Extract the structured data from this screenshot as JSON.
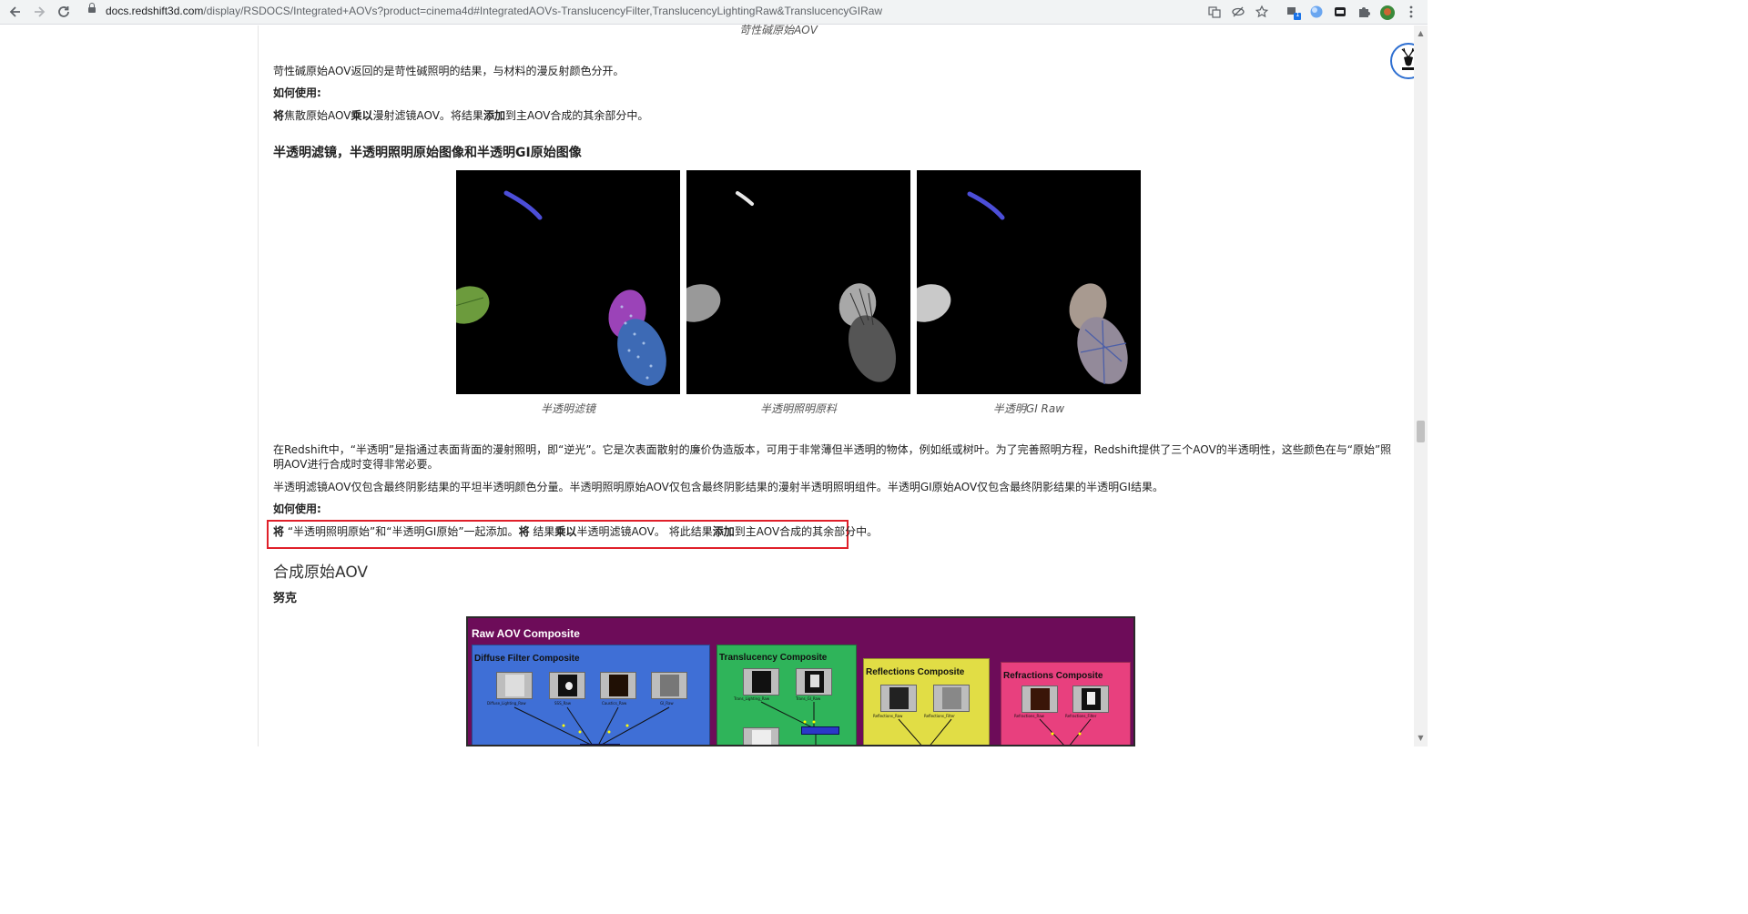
{
  "browser": {
    "url_host": "docs.redshift3d.com",
    "url_path": "/display/RSDOCS/Integrated+AOVs?product=cinema4d#IntegratedAOVs-TranslucencyFilter,TranslucencyLightingRaw&TranslucencyGIRaw",
    "nav_icons": [
      "back-icon",
      "forward-icon",
      "reload-icon"
    ],
    "toolbar_icons": [
      "translate-icon",
      "eye-off-icon",
      "star-icon",
      "extension-badge-icon",
      "globe-icon",
      "media-icon",
      "puzzle-icon",
      "profile-avatar-icon",
      "menu-kebab-icon"
    ],
    "extension_badge_count": "1"
  },
  "caustic_section": {
    "prev_caption": "苛性碱原始AOV",
    "desc": "苛性碱原始AOV返回的是苛性碱照明的结果，与材料的漫反射颜色分开。",
    "howto_label": "如何使用:",
    "howto_text": {
      "p1": "将",
      "p2": "焦散原始AOV",
      "p3": "乘以",
      "p4": "漫射滤镜AOV。将结果",
      "p5": "添加",
      "p6": "到主AOV合成的其余部分中。"
    }
  },
  "translucency_section": {
    "heading": "半透明滤镜，半透明照明原始图像和半透明GI原始图像",
    "images": [
      {
        "caption": "半透明滤镜"
      },
      {
        "caption": "半透明照明原料"
      },
      {
        "caption": "半透明GI Raw"
      }
    ],
    "para1_line1": "在Redshift中，“半透明”是指通过表面背面的漫射照明，即“逆光”。它是次表面散射的廉价伪造版本，可用于非常薄但半透明的物体，例如纸或树叶。为了完善照明方程，Redshift提供了三个AOV的半透明性，这些颜色在与“原始”照",
    "para1_line2": "明AOV进行合成时变得非常必要。",
    "para2": "半透明滤镜AOV仅包含最终阴影结果的平坦半透明颜色分量。半透明照明原始AOV仅包含最终阴影结果的漫射半透明照明组件。半透明GI原始AOV仅包含最终阴影结果的半透明GI结果。",
    "howto_label": "如何使用:",
    "howto_text": {
      "p1": "将",
      "p2": "“半透明照明原始”和“半透明GI原始”一起添加。",
      "p3": "将",
      "p4": "结果",
      "p5": "乘以",
      "p6": "半透明滤镜AOV。  将此结果",
      "p7": "添加",
      "p8": "到主AOV合成的其余部分中。"
    }
  },
  "composite_section": {
    "heading": "合成原始AOV",
    "subheading": "努克",
    "diagram": {
      "title": "Raw AOV Composite",
      "panels": [
        {
          "title": "Diffuse Filter Composite",
          "color": "#3f6fd6",
          "nodes": [
            "Diffuse_Lighting_Raw",
            "SSS_Raw",
            "Caustics_Raw",
            "GI_Raw"
          ]
        },
        {
          "title": "Translucency Composite",
          "color": "#2fb45a",
          "nodes": [
            "Trans_Lighting_Raw",
            "Trans_GI_Raw"
          ]
        },
        {
          "title": "Reflections Composite",
          "color": "#e1dd45",
          "nodes": [
            "Reflections_Raw",
            "Reflections_Filter"
          ]
        },
        {
          "title": "Refractions Composite",
          "color": "#e8407e",
          "nodes": [
            "Refractions_Raw",
            "Refractions_Filter"
          ]
        }
      ]
    }
  },
  "colors": {
    "highlight_border": "#e0202a",
    "badge_ring": "#2e6fd1",
    "diagram_bg": "#6d0c59"
  }
}
